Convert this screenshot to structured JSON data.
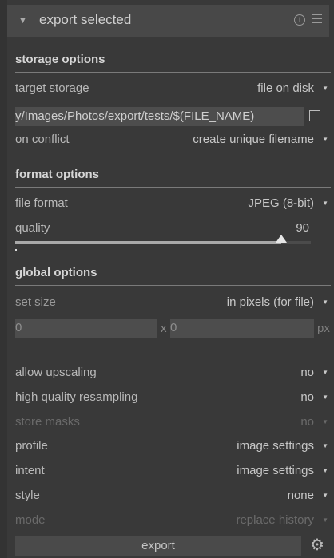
{
  "header": {
    "title": "export selected",
    "info_icon": "info-icon",
    "menu_icon": "hamburger-icon"
  },
  "storage": {
    "title": "storage options",
    "target_storage_label": "target storage",
    "target_storage_value": "file on disk",
    "path": "y/Images/Photos/export/tests/$(FILE_NAME)",
    "on_conflict_label": "on conflict",
    "on_conflict_value": "create unique filename"
  },
  "format": {
    "title": "format options",
    "file_format_label": "file format",
    "file_format_value": "JPEG (8-bit)",
    "quality_label": "quality",
    "quality_value": "90",
    "quality_fraction": 0.9
  },
  "global": {
    "title": "global options",
    "set_size_label": "set size",
    "set_size_value": "in pixels (for file)",
    "width": "0",
    "height": "0",
    "x_sep": "x",
    "unit": "px",
    "allow_upscaling_label": "allow upscaling",
    "allow_upscaling_value": "no",
    "hq_label": "high quality resampling",
    "hq_value": "no",
    "store_masks_label": "store masks",
    "store_masks_value": "no",
    "profile_label": "profile",
    "profile_value": "image settings",
    "intent_label": "intent",
    "intent_value": "image settings",
    "style_label": "style",
    "style_value": "none",
    "mode_label": "mode",
    "mode_value": "replace history"
  },
  "actions": {
    "export_label": "export",
    "settings_icon": "gear-icon"
  },
  "colors": {
    "panel": "#393939",
    "header": "#484848",
    "field": "#4d4d4d"
  }
}
